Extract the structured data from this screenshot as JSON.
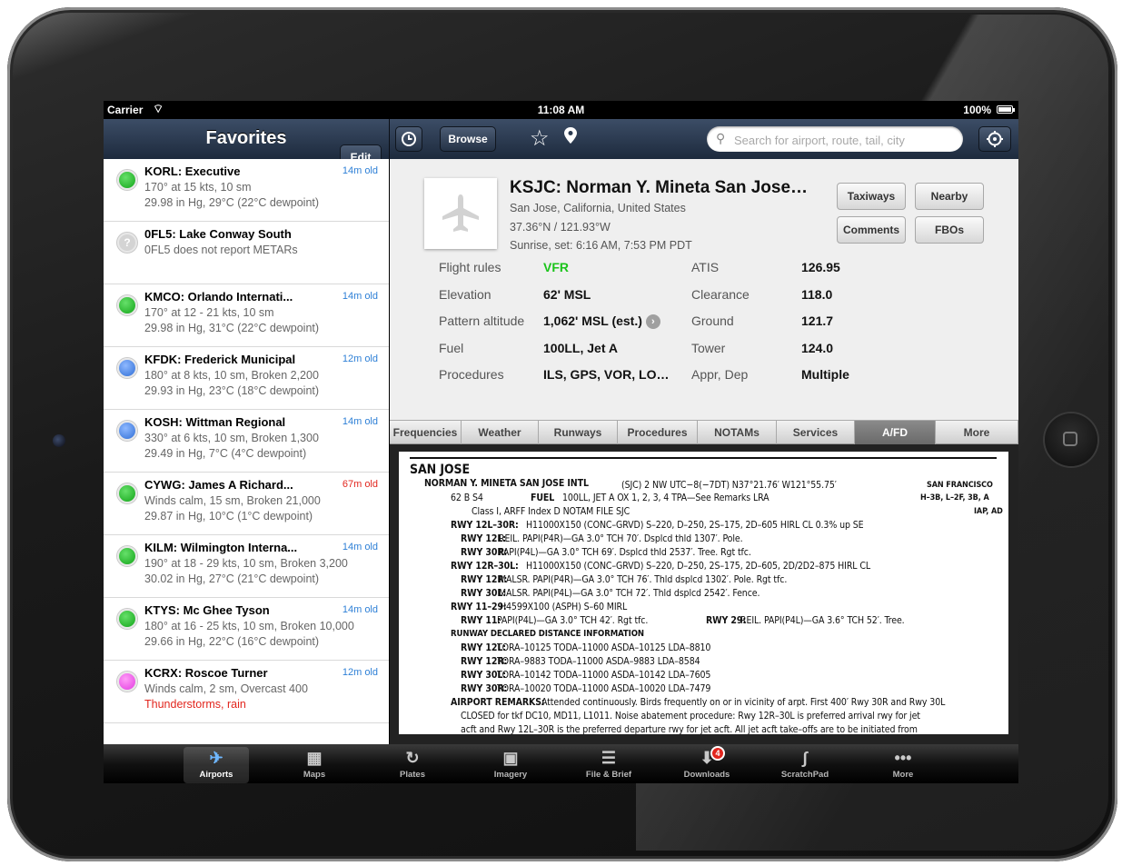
{
  "status_bar": {
    "carrier": "Carrier",
    "time": "11:08 AM",
    "battery": "100%",
    "battery_level": 1.0
  },
  "favorites": {
    "title": "Favorites",
    "edit_label": "Edit",
    "items": [
      {
        "name": "KORL: Executive",
        "age": "14m old",
        "age_color": "blue",
        "status": "green",
        "line1": "170° at 15 kts, 10 sm",
        "line2": "29.98 in Hg, 29°C (22°C dewpoint)"
      },
      {
        "name": "0FL5: Lake Conway South",
        "age": "",
        "age_color": "blue",
        "status": "unknown",
        "line1": "0FL5 does not report METARs",
        "line2": ""
      },
      {
        "name": "KMCO: Orlando Internati...",
        "age": "14m old",
        "age_color": "blue",
        "status": "green",
        "line1": "170° at 12 - 21 kts, 10 sm",
        "line2": "29.98 in Hg, 31°C (22°C dewpoint)"
      },
      {
        "name": "KFDK: Frederick Municipal",
        "age": "12m old",
        "age_color": "blue",
        "status": "blue",
        "line1": "180° at 8 kts, 10 sm, Broken 2,200",
        "line2": "29.93 in Hg, 23°C (18°C dewpoint)"
      },
      {
        "name": "KOSH: Wittman Regional",
        "age": "14m old",
        "age_color": "blue",
        "status": "blue",
        "line1": "330° at 6 kts, 10 sm, Broken 1,300",
        "line2": "29.49 in Hg, 7°C (4°C dewpoint)"
      },
      {
        "name": "CYWG: James A Richard...",
        "age": "67m old",
        "age_color": "red",
        "status": "green",
        "line1": "Winds calm, 15 sm, Broken 21,000",
        "line2": "29.87 in Hg, 10°C (1°C dewpoint)"
      },
      {
        "name": "KILM: Wilmington Interna...",
        "age": "14m old",
        "age_color": "blue",
        "status": "green",
        "line1": "190° at 18 - 29 kts, 10 sm, Broken 3,200",
        "line2": "30.02 in Hg, 27°C (21°C dewpoint)"
      },
      {
        "name": "KTYS: Mc Ghee Tyson",
        "age": "14m old",
        "age_color": "blue",
        "status": "green",
        "line1": "180° at 16 - 25 kts, 10 sm, Broken 10,000",
        "line2": "29.66 in Hg, 22°C (16°C dewpoint)"
      },
      {
        "name": "KCRX: Roscoe Turner",
        "age": "12m old",
        "age_color": "blue",
        "status": "magenta",
        "line1": "Winds calm, 2 sm, Overcast 400",
        "line2": "Thunderstorms, rain",
        "line2_color": "red"
      }
    ]
  },
  "toolbar": {
    "browse_label": "Browse",
    "search_placeholder": "Search for airport, route, tail, city"
  },
  "airport": {
    "title": "KSJC: Norman Y. Mineta San Jose…",
    "location": "San Jose, California, United States",
    "coordinates": "37.36°N / 121.93°W",
    "sun": "Sunrise, set: 6:16 AM, 7:53 PM PDT",
    "buttons": {
      "taxiways": "Taxiways",
      "nearby": "Nearby",
      "comments": "Comments",
      "fbos": "FBOs"
    },
    "info_left": [
      {
        "label": "Flight rules",
        "value": "VFR"
      },
      {
        "label": "Elevation",
        "value": "62' MSL"
      },
      {
        "label": "Pattern altitude",
        "value": "1,062' MSL (est.)"
      },
      {
        "label": "Fuel",
        "value": "100LL, Jet A"
      },
      {
        "label": "Procedures",
        "value": "ILS, GPS, VOR, LO…"
      }
    ],
    "info_right": [
      {
        "label": "ATIS",
        "value": "126.95"
      },
      {
        "label": "Clearance",
        "value": "118.0"
      },
      {
        "label": "Ground",
        "value": "121.7"
      },
      {
        "label": "Tower",
        "value": "124.0"
      },
      {
        "label": "Appr, Dep",
        "value": "Multiple"
      }
    ]
  },
  "detail_tabs": [
    "Frequencies",
    "Weather",
    "Runways",
    "Procedures",
    "NOTAMs",
    "Services",
    "A/FD",
    "More"
  ],
  "active_tab": "A/FD",
  "afd": {
    "city": "SAN JOSE",
    "lines": [
      "NORMAN Y. MINETA SAN JOSE INTL",
      "(SJC)    2 NW    UTC−8(−7DT)    N37°21.76′ W121°55.75′",
      "SAN FRANCISCO",
      "62    B    S4",
      "FUEL",
      "100LL, JET A    OX 1, 2, 3, 4    TPA—See Remarks    LRA",
      "H–3B, L–2F, 3B, A",
      "Class I, ARFF Index D    NOTAM FILE SJC",
      "IAP, AD",
      "RWY 12L–30R:",
      "H11000X150 (CONC–GRVD)    S–220, D–250, 2S–175, 2D–605    HIRL    CL    0.3% up SE",
      "RWY 12L:",
      "REIL. PAPI(P4R)—GA 3.0° TCH 70′. Dsplcd thld 1307′. Pole.",
      "RWY 30R:",
      "PAPI(P4L)—GA 3.0° TCH 69′. Dsplcd thld 2537′. Tree. Rgt tfc.",
      "RWY 12R–30L:",
      "H11000X150 (CONC–GRVD)    S–220, D–250, 2S–175, 2D–605, 2D/2D2–875    HIRL    CL",
      "RWY 12R:",
      "MALSR. PAPI(P4R)—GA 3.0° TCH 76′. Thld dsplcd 1302′. Pole. Rgt tfc.",
      "RWY 30L:",
      "MALSR. PAPI(P4L)—GA 3.0° TCH 72′. Thld dsplcd 2542′. Fence.",
      "RWY 11–29:",
      "H4599X100 (ASPH)    S–60    MIRL",
      "RWY 11:",
      "PAPI(P4L)—GA 3.0° TCH 42′. Rgt tfc.",
      "RWY 29:",
      "REIL. PAPI(P4L)—GA 3.6° TCH 52′. Tree.",
      "RUNWAY DECLARED DISTANCE INFORMATION",
      "RWY 12L:",
      "TORA–10125    TODA–11000    ASDA–10125    LDA–8810",
      "RWY 12R:",
      "TORA–9883     TODA–11000    ASDA–9883     LDA–8584",
      "RWY 30L:",
      "TORA–10142    TODA–11000    ASDA–10142    LDA–7605",
      "RWY 30R:",
      "TORA–10020    TODA–11000    ASDA–10020    LDA–7479",
      "AIRPORT REMARKS:",
      "Attended continuously. Birds frequently on or in vicinity of arpt. First 400′ Rwy 30R and Rwy 30L",
      "CLOSED for tkf DC10, MD11, L1011. Noise abatement procedure: Rwy 12R–30L is preferred arrival rwy for jet",
      "acft and Rwy 12L–30R is the preferred departure rwy for jet acft. All jet acft take–offs are to be initiated from"
    ]
  },
  "tab_bar": {
    "items": [
      {
        "label": "Airports",
        "icon": "airplane-icon",
        "active": true
      },
      {
        "label": "Maps",
        "icon": "map-icon"
      },
      {
        "label": "Plates",
        "icon": "plates-icon"
      },
      {
        "label": "Imagery",
        "icon": "imagery-icon"
      },
      {
        "label": "File & Brief",
        "icon": "file-brief-icon"
      },
      {
        "label": "Downloads",
        "icon": "download-icon",
        "badge": "4"
      },
      {
        "label": "ScratchPad",
        "icon": "scratchpad-icon"
      },
      {
        "label": "More",
        "icon": "more-dots-icon"
      }
    ]
  },
  "colors": {
    "header": "#2b3a52",
    "vfr": "#1bc41b",
    "age_blue": "#2d7fd6",
    "age_red": "#e2261e"
  }
}
